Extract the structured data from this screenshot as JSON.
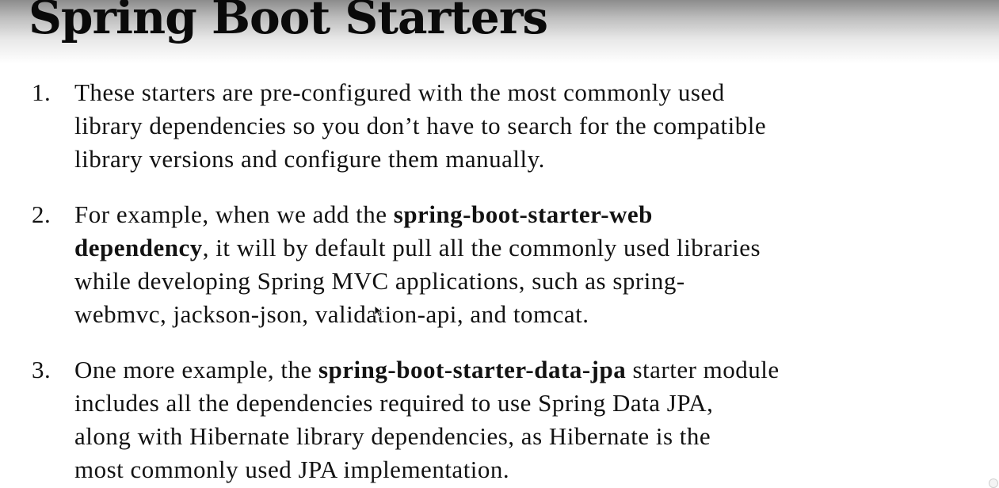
{
  "slide": {
    "title": "Spring Boot Starters",
    "points": [
      {
        "number": "1.",
        "lines": [
          [
            "These starters are pre-configured with the most commonly used"
          ],
          [
            "library dependencies so you don’t have to search for the compatible"
          ],
          [
            "library versions and configure them manually."
          ]
        ]
      },
      {
        "number": "2.",
        "lines": [
          [
            "For example, when we add the ",
            "spring-boot-starter-web"
          ],
          [
            "dependency",
            ", it will by default pull all the commonly used libraries"
          ],
          [
            "while developing Spring MVC applications, such as spring-"
          ],
          [
            "webmvc, jackson-json, validation-api, and tomcat."
          ]
        ]
      },
      {
        "number": "3.",
        "lines": [
          [
            "One more example, the ",
            "spring-boot-starter-data-jpa",
            " starter module"
          ],
          [
            "includes all the dependencies required to use Spring Data JPA,"
          ],
          [
            "along with Hibernate library dependencies, as Hibernate is the"
          ],
          [
            "most commonly used JPA implementation."
          ]
        ]
      }
    ]
  },
  "icons": {
    "cursor": "mouse-pointer-icon",
    "corner": "player-corner-icon"
  }
}
